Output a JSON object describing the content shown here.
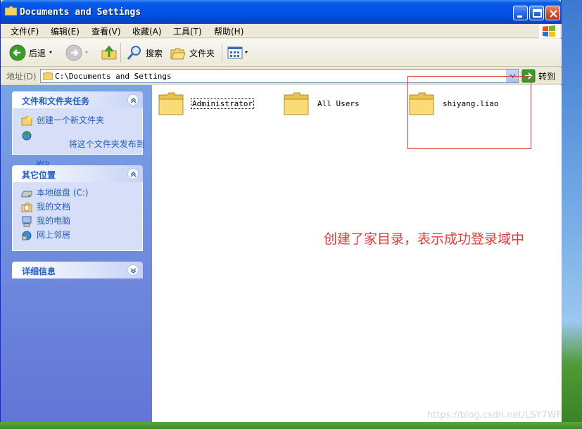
{
  "window": {
    "title": "Documents and Settings"
  },
  "menu": [
    "文件(F)",
    "编辑(E)",
    "查看(V)",
    "收藏(A)",
    "工具(T)",
    "帮助(H)"
  ],
  "toolbar": {
    "back_label": "后退",
    "search_label": "搜索",
    "folders_label": "文件夹"
  },
  "address": {
    "label": "地址(D)",
    "value": "C:\\Documents and Settings",
    "go_label": "转到"
  },
  "sidebar": {
    "panels": [
      {
        "title": "文件和文件夹任务",
        "items": [
          {
            "label": "创建一个新文件夹",
            "icon": "new-folder-icon"
          },
          {
            "label": "将这个文件夹发布到",
            "sublabel": "Web",
            "icon": "publish-web-icon"
          }
        ]
      },
      {
        "title": "其它位置",
        "items": [
          {
            "label": "本地磁盘 (C:)",
            "icon": "drive-icon"
          },
          {
            "label": "我的文档",
            "icon": "my-documents-icon"
          },
          {
            "label": "我的电脑",
            "icon": "my-computer-icon"
          },
          {
            "label": "网上邻居",
            "icon": "network-icon"
          }
        ]
      },
      {
        "title": "详细信息",
        "items": []
      }
    ]
  },
  "folders": [
    {
      "name": "Administrator",
      "focused": true
    },
    {
      "name": "All Users",
      "focused": false
    },
    {
      "name": "shiyang.liao",
      "focused": false
    }
  ],
  "annotation": "创建了家目录，表示成功登录域中",
  "watermark": "https://blog.csdn.net/LSY7WF",
  "colors": {
    "title_bar": "#0454e6",
    "sidebar_bg": "#7ba2e7",
    "annotation": "#e23a3a",
    "task_link": "#215dc6"
  }
}
